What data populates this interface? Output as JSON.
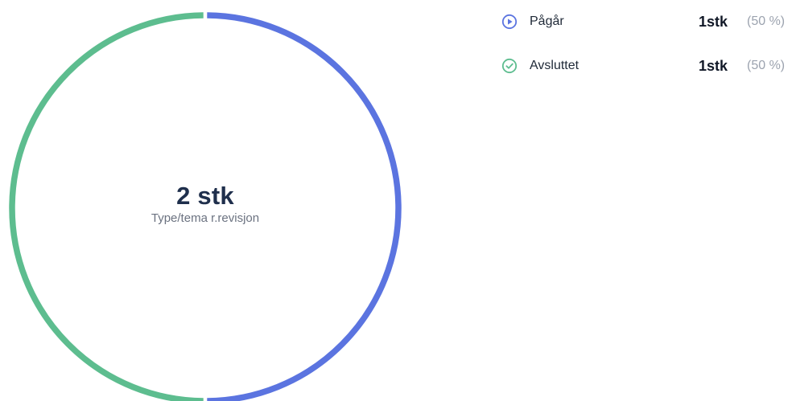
{
  "chart_data": {
    "type": "pie",
    "categories": [
      "Pågår",
      "Avsluttet"
    ],
    "values": [
      1,
      1
    ],
    "total_label": "2 stk",
    "caption": "Type/tema r.revisjon",
    "series_colors": [
      "#5b74e0",
      "#5dbd8f"
    ]
  },
  "legend": {
    "items": [
      {
        "label": "Pågår",
        "count": "1stk",
        "pct": "(50 %)",
        "icon": "play-circle-icon",
        "color": "#5b74e0"
      },
      {
        "label": "Avsluttet",
        "count": "1stk",
        "pct": "(50 %)",
        "icon": "check-circle-icon",
        "color": "#5dbd8f"
      }
    ]
  }
}
